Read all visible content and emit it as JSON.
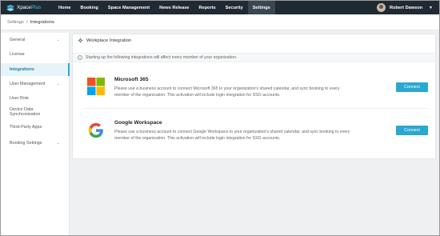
{
  "app": {
    "logo_main": "Xpace",
    "logo_accent": "Plus"
  },
  "topnav": {
    "items": [
      "Home",
      "Booking",
      "Space Management",
      "News Release",
      "Reports",
      "Security",
      "Settings"
    ],
    "active_index": 6
  },
  "user": {
    "name": "Robert Dawson"
  },
  "breadcrumb": {
    "parent": "Settings",
    "separator": "/",
    "current": "Integrations"
  },
  "sidebar": {
    "items": [
      {
        "label": "General",
        "expandable": true
      },
      {
        "label": "License",
        "expandable": false
      },
      {
        "label": "Integrations",
        "expandable": false,
        "active": true
      },
      {
        "label": "User Management",
        "expandable": true
      },
      {
        "label": "User Role",
        "expandable": false
      },
      {
        "label": "Device Data Synchronization",
        "expandable": false
      },
      {
        "label": "Third-Party Apps",
        "expandable": false
      },
      {
        "label": "Booking Settings",
        "expandable": true
      }
    ]
  },
  "main": {
    "title": "Workplace Integration",
    "notice": "Starting up the following integrations will affect every member of your organization.",
    "integrations": [
      {
        "name": "Microsoft 365",
        "description": "Please use a business account to connect Microsoft 365 to your organization's shared calendar, and sync booking to every member of the organization. This activation will include login integration for SSO accounts.",
        "button": "Connect",
        "icon": "microsoft-logo-icon"
      },
      {
        "name": "Google Workspace",
        "description": "Please use a business account to connect Google Workspace to your organization's shared calendar, and sync booking to every member of the organization. This activation will include login integration for SSO accounts.",
        "button": "Connect",
        "icon": "google-logo-icon"
      }
    ]
  },
  "colors": {
    "nav_bg": "#1f2a33",
    "accent": "#2aa8cf",
    "active_side_bg": "#e6f4f8"
  }
}
